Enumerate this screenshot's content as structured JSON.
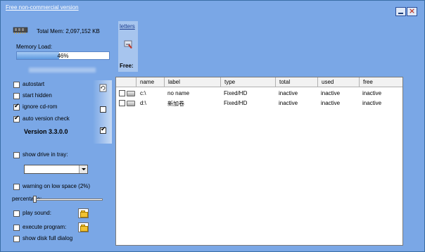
{
  "window": {
    "title_link": "Free non-commercial version",
    "minimize_label": "",
    "close_label": "×"
  },
  "memory": {
    "total_mem_text": "Total Mem: 2,097,152 KB",
    "load_label": "Memory Load:",
    "load_percent_text": "46%",
    "load_fraction": 0.46
  },
  "letters": {
    "link": "letters",
    "free_label": "Free:"
  },
  "options": {
    "autostart": {
      "label": "autostart",
      "checked": false
    },
    "start_hidden": {
      "label": "start hidden",
      "checked": false
    },
    "ignore_cdrom": {
      "label": "ignore cd-rom",
      "checked": true
    },
    "auto_version_check": {
      "label": "auto version check",
      "checked": true
    },
    "version": "Version 3.3.0.0",
    "show_drive_in_tray": {
      "label": "show drive in tray:",
      "checked": false
    },
    "tray_drive_selected": "",
    "warning_low_space": {
      "label": "warning on low space (2%)",
      "checked": false
    },
    "percentage_label": "percentage:",
    "percentage_value": 0.02,
    "play_sound": {
      "label": "play sound:",
      "checked": false
    },
    "execute_program": {
      "label": "execute program:",
      "checked": false
    },
    "show_disk_full_dialog": {
      "label": "show disk full dialog",
      "checked": false
    }
  },
  "side_checkboxes": {
    "box1_checked": false,
    "box2_checked": true
  },
  "drives_table": {
    "columns": [
      "name",
      "label",
      "type",
      "total",
      "used",
      "free"
    ],
    "rows": [
      {
        "name": "c:\\",
        "label": "no name",
        "type": "Fixed/HD",
        "total": "inactive",
        "used": "inactive",
        "free": "inactive"
      },
      {
        "name": "d:\\",
        "label": "新加卷",
        "type": "Fixed/HD",
        "total": "inactive",
        "used": "inactive",
        "free": "inactive"
      }
    ]
  },
  "colors": {
    "window_bg": "#7aa7e6",
    "title_link": "#ffffff",
    "progress_fill": "#5e9ae0"
  }
}
